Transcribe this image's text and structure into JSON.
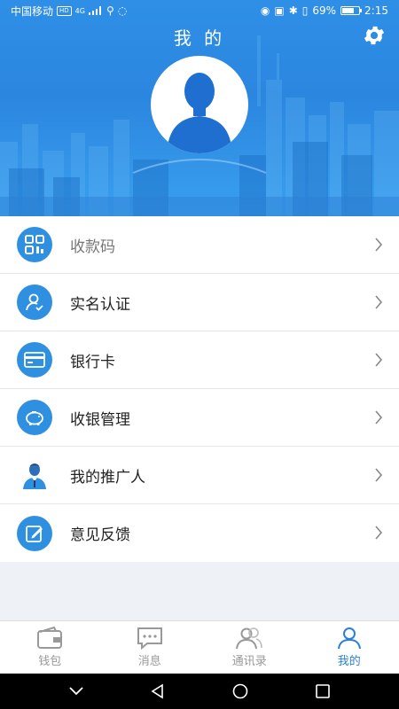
{
  "status": {
    "carrier": "中国移动",
    "hd": "HD",
    "signal": "4G",
    "battery_pct": "69%",
    "battery_level": 0.69,
    "time": "2:15"
  },
  "header": {
    "title": "我 的"
  },
  "menu": {
    "items": [
      {
        "label": "收款码",
        "icon": "qr-code-icon"
      },
      {
        "label": "实名认证",
        "icon": "user-verify-icon"
      },
      {
        "label": "银行卡",
        "icon": "bank-card-icon"
      },
      {
        "label": "收银管理",
        "icon": "piggy-bank-icon"
      },
      {
        "label": "我的推广人",
        "icon": "promoter-icon"
      },
      {
        "label": "意见反馈",
        "icon": "feedback-edit-icon"
      }
    ]
  },
  "tabs": [
    {
      "label": "钱包",
      "icon": "wallet-icon"
    },
    {
      "label": "消息",
      "icon": "message-icon"
    },
    {
      "label": "通讯录",
      "icon": "contacts-icon"
    },
    {
      "label": "我的",
      "icon": "profile-icon"
    }
  ],
  "colors": {
    "accent": "#2f8fe0",
    "active_tab": "#2a7fd6"
  }
}
